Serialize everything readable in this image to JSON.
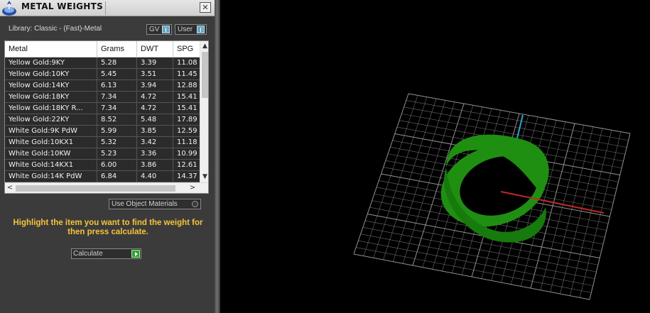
{
  "window": {
    "title": "METAL WEIGHTS",
    "close_symbol": "✕"
  },
  "library": {
    "label": "Library: Classic - (Fast)-Metal",
    "toggles": [
      {
        "label": "GV",
        "state": "on"
      },
      {
        "label": "User",
        "state": "on"
      }
    ]
  },
  "table": {
    "columns": [
      "Metal",
      "Grams",
      "DWT",
      "SPG"
    ],
    "rows": [
      [
        "Yellow Gold:9KY",
        "5.28",
        "3.39",
        "11.08"
      ],
      [
        "Yellow Gold:10KY",
        "5.45",
        "3.51",
        "11.45"
      ],
      [
        "Yellow Gold:14KY",
        "6.13",
        "3.94",
        "12.88"
      ],
      [
        "Yellow Gold:18KY",
        "7.34",
        "4.72",
        "15.41"
      ],
      [
        "Yellow Gold:18KY R...",
        "7.34",
        "4.72",
        "15.41"
      ],
      [
        "Yellow Gold:22KY",
        "8.52",
        "5.48",
        "17.89"
      ],
      [
        "White Gold:9K PdW",
        "5.99",
        "3.85",
        "12.59"
      ],
      [
        "White Gold:10KX1",
        "5.32",
        "3.42",
        "11.18"
      ],
      [
        "White Gold:10KW",
        "5.23",
        "3.36",
        "10.99"
      ],
      [
        "White Gold:14KX1",
        "6.00",
        "3.86",
        "12.61"
      ],
      [
        "White Gold:14K PdW",
        "6.84",
        "4.40",
        "14.37"
      ]
    ],
    "scroll_up": "▲",
    "scroll_down": "▼",
    "scroll_left": "<",
    "scroll_right": ">"
  },
  "use_object_materials": {
    "label": "Use Object Materials",
    "checked": false
  },
  "hint": "Highlight the item you want to find the weight for then press calculate.",
  "calculate": {
    "label": "Calculate"
  },
  "colors": {
    "panel_bg": "#3b3b3b",
    "hint_text": "#f5c43a",
    "grid": "#9a9a9a",
    "axis_x": "#c0282a",
    "axis_y": "#2aa8c8",
    "ring": "#1f8f12"
  },
  "icons": {
    "app": "rhino-app-icon",
    "close": "close-icon",
    "toggle_knob": "toggle-knob-icon",
    "radio": "radio-icon",
    "calculate_go": "play-arrow-icon"
  }
}
